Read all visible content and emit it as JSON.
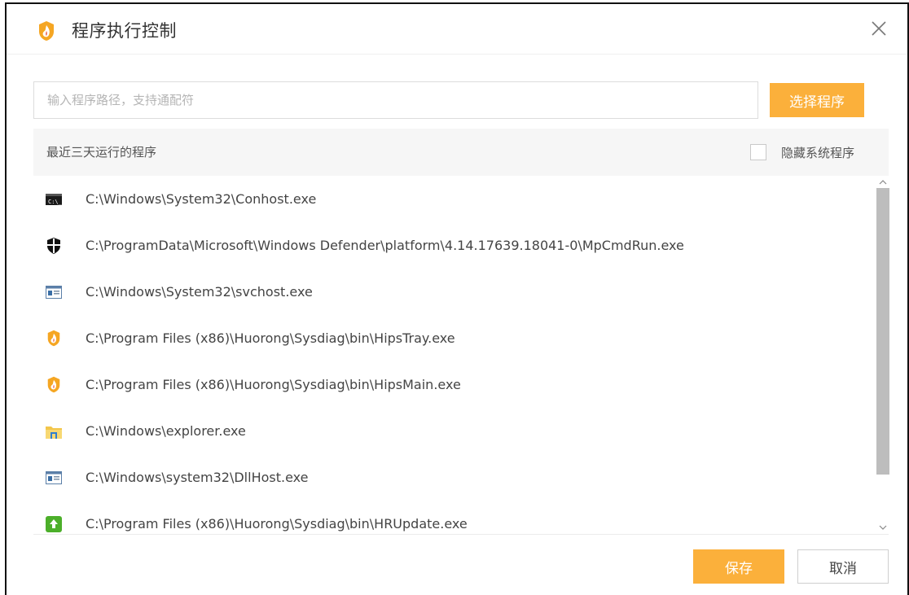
{
  "window": {
    "title": "程序执行控制"
  },
  "search": {
    "placeholder": "输入程序路径，支持通配符",
    "value": ""
  },
  "buttons": {
    "choose_program": "选择程序",
    "save": "保存",
    "cancel": "取消"
  },
  "list_header": {
    "label": "最近三天运行的程序",
    "hide_system_label": "隐藏系统程序",
    "hide_system_checked": false
  },
  "programs": [
    {
      "icon": "console-icon",
      "path": "C:\\Windows\\System32\\Conhost.exe"
    },
    {
      "icon": "defender-shield-icon",
      "path": "C:\\ProgramData\\Microsoft\\Windows Defender\\platform\\4.14.17639.18041-0\\MpCmdRun.exe"
    },
    {
      "icon": "window-app-icon",
      "path": "C:\\Windows\\System32\\svchost.exe"
    },
    {
      "icon": "huorong-icon",
      "path": "C:\\Program Files (x86)\\Huorong\\Sysdiag\\bin\\HipsTray.exe"
    },
    {
      "icon": "huorong-icon",
      "path": "C:\\Program Files (x86)\\Huorong\\Sysdiag\\bin\\HipsMain.exe"
    },
    {
      "icon": "explorer-folder-icon",
      "path": "C:\\Windows\\explorer.exe"
    },
    {
      "icon": "window-app-icon",
      "path": "C:\\Windows\\system32\\DllHost.exe"
    },
    {
      "icon": "update-icon",
      "path": "C:\\Program Files (x86)\\Huorong\\Sysdiag\\bin\\HRUpdate.exe"
    }
  ],
  "colors": {
    "accent": "#fbb03b",
    "header_bg": "#f6f6f6",
    "scrollbar": "#bdbdbd"
  }
}
